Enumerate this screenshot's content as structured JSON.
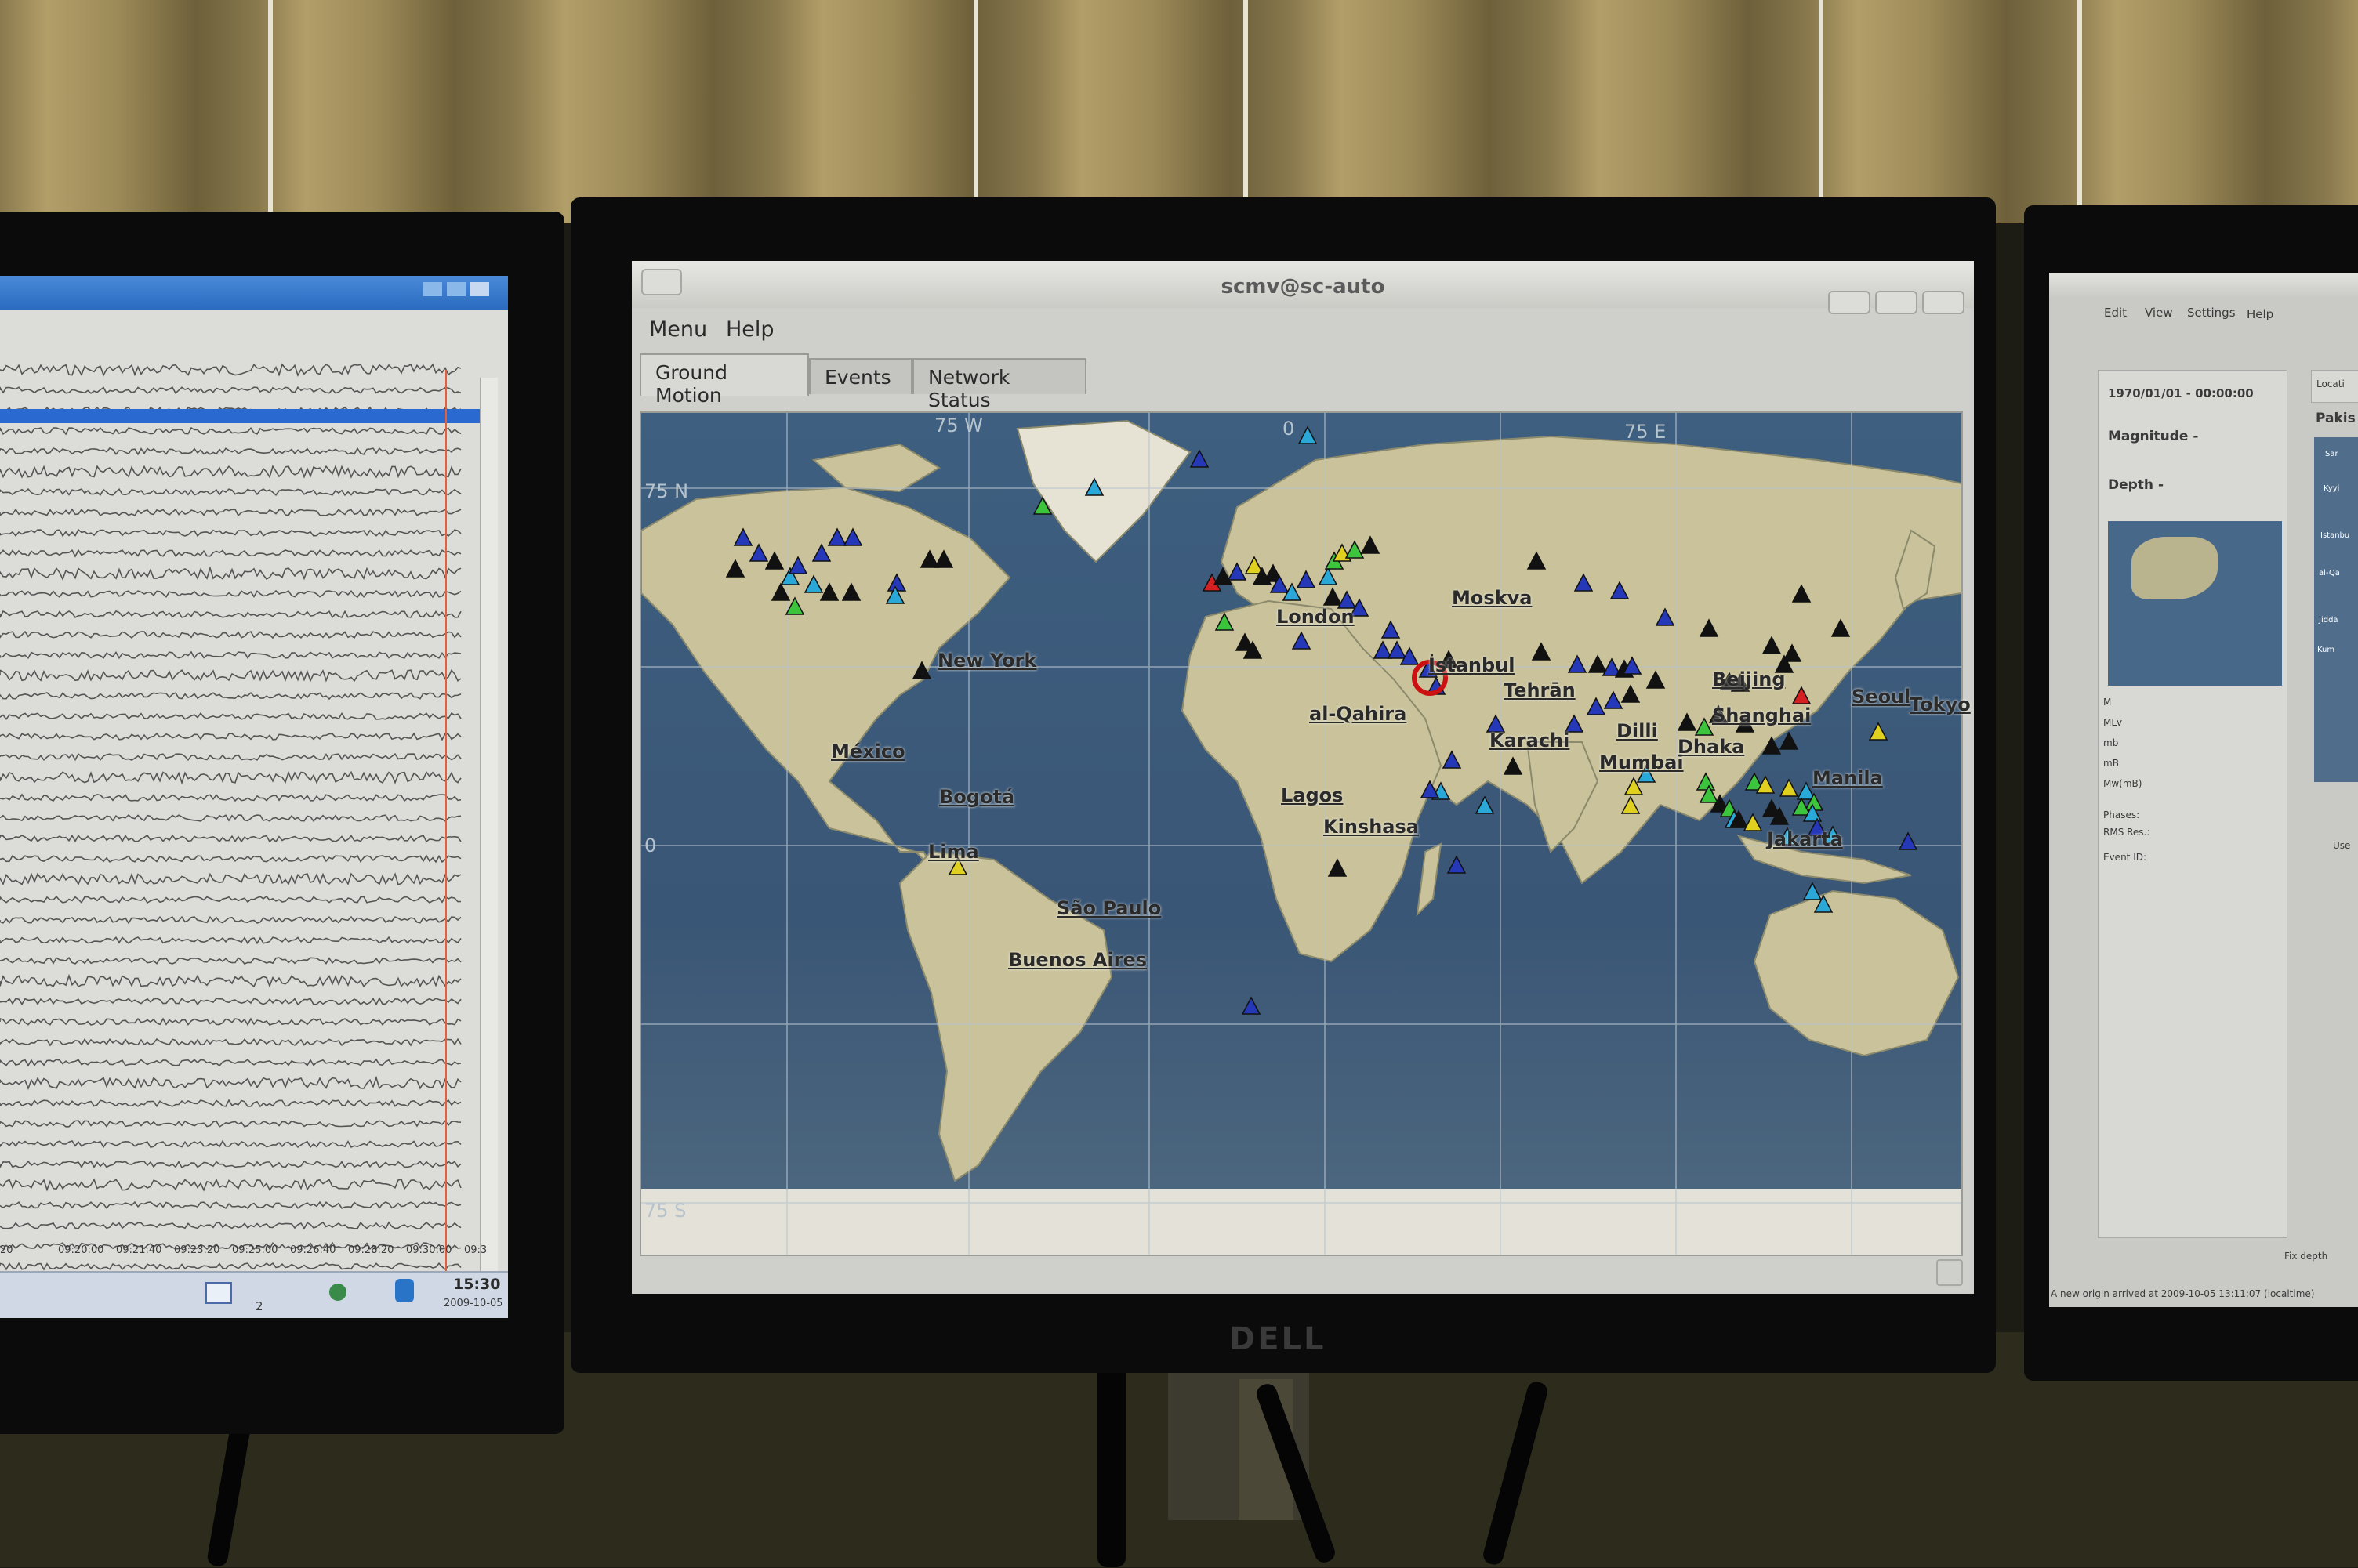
{
  "center_window": {
    "title": "scmv@sc-auto",
    "menu": [
      "Menu",
      "Help"
    ],
    "tabs": [
      "Ground Motion",
      "Events",
      "Network Status"
    ],
    "active_tab": "Ground Motion",
    "map": {
      "grid_labels": [
        "75 W",
        "0",
        "75 E",
        "75 N",
        "0",
        "75 S"
      ],
      "cities": [
        "Moskva",
        "London",
        "New York",
        "İstanbul",
        "Tehrān",
        "Beijing",
        "Seoul",
        "Tokyo",
        "Shanghai",
        "al-Qahira",
        "Karachi",
        "Dilli",
        "Mumbai",
        "Dhaka",
        "México",
        "Bogotá",
        "Lagos",
        "Manila",
        "Kinshasa",
        "Lima",
        "São Paulo",
        "Buenos Aires",
        "Jakarta"
      ],
      "event_marker_color": "#cc1111",
      "station_colors": {
        "black": "#111111",
        "blue": "#2438b8",
        "cyan": "#2aa8d8",
        "green": "#3cc43c",
        "yellow": "#e0d020",
        "red": "#d42020"
      }
    }
  },
  "left_window": {
    "time_ticks": [
      "20",
      "09:20:00",
      "09:21:40",
      "09:23:20",
      "09:25:00",
      "09:26:40",
      "09:28:20",
      "09:30:00",
      "09:3"
    ],
    "clock_time": "15:30",
    "clock_date": "2009-10-05",
    "taskbar_page": "2"
  },
  "right_window": {
    "menu": [
      "Edit",
      "View",
      "Settings",
      "Help"
    ],
    "origin_time": "1970/01/01 - 00:00:00",
    "magnitude_label": "Magnitude -",
    "depth_label": "Depth -",
    "location_tab": "Locati",
    "location_preview": "Pakis",
    "mini_map_labels": [
      "Sar",
      "Kyyi",
      "İstanbu",
      "al-Qa",
      "Jidda",
      "Kum"
    ],
    "magnitude_rows": [
      "M",
      "MLv",
      "mb",
      "mB",
      "Mw(mB)"
    ],
    "info_rows": [
      "Phases:",
      "RMS Res.:",
      "Event ID:"
    ],
    "use_label": "Use",
    "fix_depth": "Fix depth",
    "status": "A new origin arrived at 2009-10-05 13:11:07 (localtime)"
  },
  "monitor_brand": "DELL"
}
